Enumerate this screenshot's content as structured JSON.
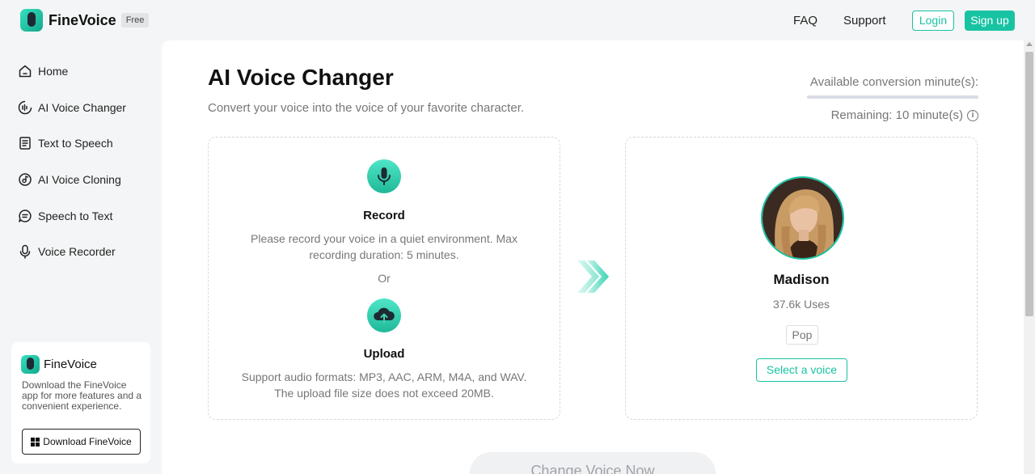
{
  "brand": {
    "name": "FineVoice",
    "badge": "Free"
  },
  "header": {
    "faq": "FAQ",
    "support": "Support",
    "login": "Login",
    "signup": "Sign up"
  },
  "sidebar": {
    "items": [
      {
        "label": "Home",
        "icon": "home-icon"
      },
      {
        "label": "AI Voice Changer",
        "icon": "voice-wave-icon"
      },
      {
        "label": "Text to Speech",
        "icon": "document-icon"
      },
      {
        "label": "AI Voice Cloning",
        "icon": "clone-disc-icon"
      },
      {
        "label": "Speech to Text",
        "icon": "speech-bubble-icon"
      },
      {
        "label": "Voice Recorder",
        "icon": "microphone-icon"
      }
    ],
    "promo": {
      "title": "FineVoice",
      "description": "Download the FineVoice app for more features and a convenient experience.",
      "button": "Download FineVoice"
    }
  },
  "main": {
    "title": "AI Voice Changer",
    "subtitle": "Convert your voice into the voice of your favorite character.",
    "minutes_label": "Available conversion minute(s):",
    "minutes_fraction": 1.0,
    "remaining": "Remaining: 10 minute(s)",
    "record": {
      "title": "Record",
      "description": "Please record your voice in a quiet environment. Max recording duration: 5 minutes."
    },
    "or": "Or",
    "upload": {
      "title": "Upload",
      "description": "Support audio formats: MP3, AAC, ARM, M4A, and WAV. The upload file size does not exceed 20MB."
    },
    "voice": {
      "name": "Madison",
      "uses": "37.6k Uses",
      "tag": "Pop",
      "select": "Select a voice"
    },
    "change_button": "Change Voice Now"
  },
  "colors": {
    "accent": "#18c3a2",
    "background": "#f4f5f6"
  }
}
